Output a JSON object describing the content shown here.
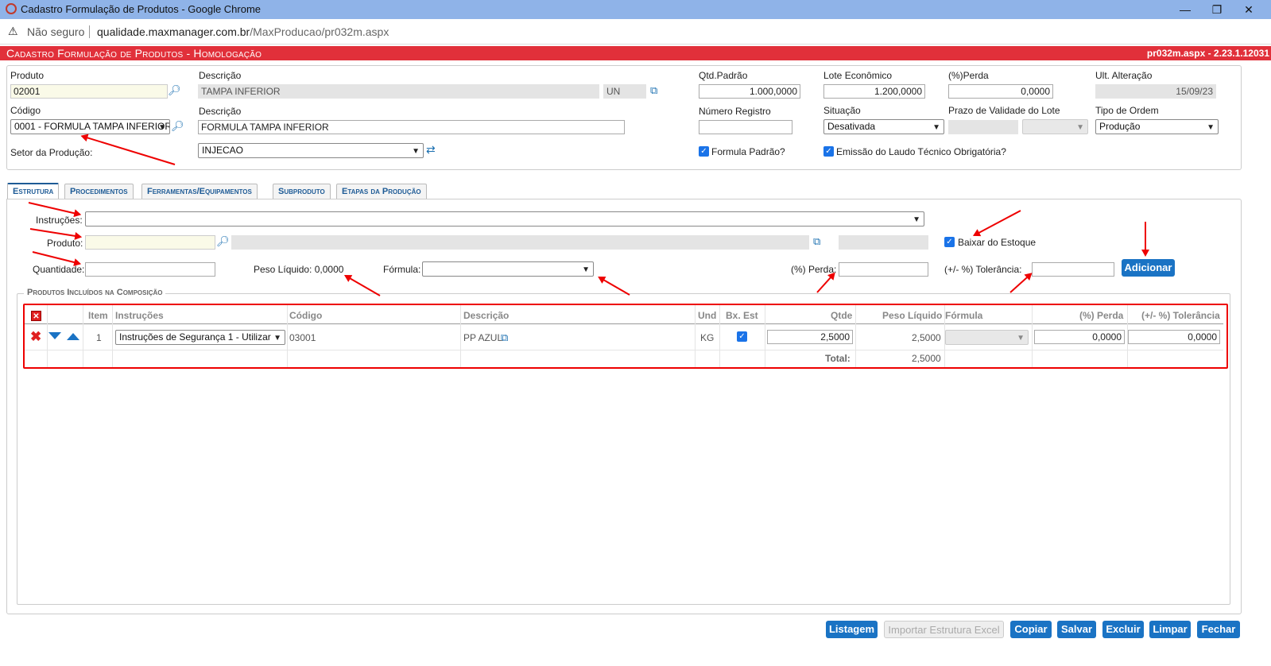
{
  "window": {
    "title": "Cadastro Formulação de Produtos - Google Chrome",
    "min": "—",
    "max": "❐",
    "close": "✕"
  },
  "address": {
    "warning": "Não seguro",
    "host": "qualidade.maxmanager.com.br",
    "path": "/MaxProducao/pr032m.aspx"
  },
  "header": {
    "title": "Cadastro Formulação de Produtos  - Homologação",
    "version": "pr032m.aspx - 2.23.1.12031"
  },
  "form": {
    "produto_label": "Produto",
    "produto_value": "02001",
    "descricao_label": "Descrição",
    "descricao_value": "TAMPA INFERIOR",
    "unidade_value": "UN",
    "qtd_padrao_label": "Qtd.Padrão",
    "qtd_padrao_value": "1.000,0000",
    "lote_label": "Lote Econômico",
    "lote_value": "1.200,0000",
    "perda_label": "(%)Perda",
    "perda_value": "0,0000",
    "ult_alt_label": "Ult. Alteração",
    "ult_alt_value": "15/09/23",
    "codigo_label": "Código",
    "codigo_value": "0001 - FORMULA TAMPA INFERIOR",
    "descricao2_label": "Descrição",
    "descricao2_value": "FORMULA TAMPA INFERIOR",
    "num_registro_label": "Número Registro",
    "num_registro_value": "",
    "situacao_label": "Situação",
    "situacao_value": "Desativada",
    "prazo_label": "Prazo de Validade do Lote",
    "tipo_ordem_label": "Tipo de Ordem",
    "tipo_ordem_value": "Produção",
    "setor_label": "Setor da Produção:",
    "setor_value": "INJECAO",
    "formula_padrao_label": "Formula Padrão?",
    "laudo_label": "Emissão do Laudo Técnico Obrigatória?"
  },
  "tabs": [
    "Estrutura",
    "Procedimentos",
    "Ferramentas/Equipamentos",
    "Subproduto",
    "Etapas da Produção"
  ],
  "estrutura": {
    "instrucoes_label": "Instruções:",
    "produto_label": "Produto:",
    "baixar_label": "Baixar do Estoque",
    "quantidade_label": "Quantidade:",
    "peso_label": "Peso Líquido: 0,0000",
    "formula_label": "Fórmula:",
    "perda_label": "(%) Perda:",
    "tolerancia_label": "(+/- %) Tolerância:",
    "adicionar": "Adicionar",
    "group_title": "Produtos Incluídos na Composição"
  },
  "table": {
    "headers": [
      "Item",
      "Instruções",
      "Código",
      "Descrição",
      "Und",
      "Bx. Est",
      "Qtde",
      "Peso Líquido",
      "Fórmula",
      "(%) Perda",
      "(+/- %) Tolerância"
    ],
    "rows": [
      {
        "item": "1",
        "instrucoes": "Instruções de Segurança 1 - Utilizar",
        "codigo": "03001",
        "descricao": "PP AZUL",
        "und": "KG",
        "qtde": "2,5000",
        "peso": "2,5000",
        "perda": "0,0000",
        "tolerancia": "0,0000"
      }
    ],
    "total_label": "Total:",
    "total_value": "2,5000"
  },
  "buttons": {
    "listagem": "Listagem",
    "importar": "Importar Estrutura Excel",
    "copiar": "Copiar",
    "salvar": "Salvar",
    "excluir": "Excluir",
    "limpar": "Limpar",
    "fechar": "Fechar"
  },
  "colors": {
    "header": "#e1303a",
    "button": "#1a73c4",
    "tab_text": "#1e5b96",
    "annotation": "#e00000"
  }
}
